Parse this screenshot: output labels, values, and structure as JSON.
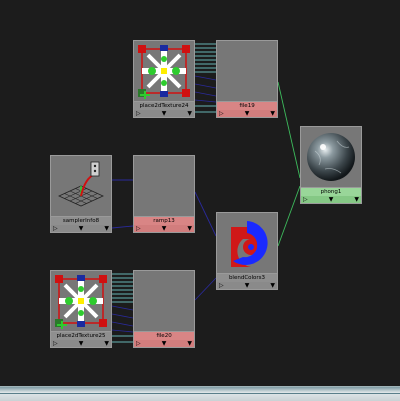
{
  "nodes": {
    "place24": {
      "label": "place2dTexture24"
    },
    "file19": {
      "label": "file19"
    },
    "sampler": {
      "label": "samplerInfo8"
    },
    "ramp": {
      "label": "ramp13"
    },
    "place25": {
      "label": "place2dTexture25"
    },
    "file20": {
      "label": "file20"
    },
    "blend": {
      "label": "blendColors3"
    },
    "phong": {
      "label": "phong1"
    }
  },
  "ports": {
    "input": "▷",
    "output": "▼"
  },
  "colors": {
    "background": "#1c1c1c",
    "util_label": "#8f8f8f",
    "texture_label": "#d98585",
    "shader_label": "#99d699",
    "wire_green": "#3dbb5c",
    "wire_cyan": "#7fe7e7",
    "wire_blue": "#2a2a9a"
  }
}
